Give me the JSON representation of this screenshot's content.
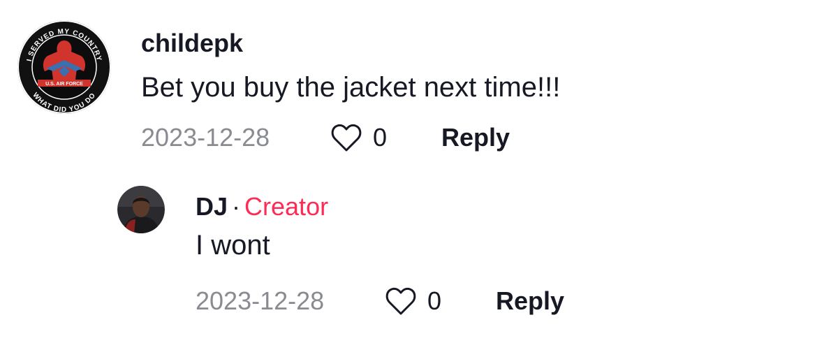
{
  "comments": [
    {
      "username": "childepk",
      "text": "Bet you buy the jacket next time!!!",
      "date": "2023-12-28",
      "likes": "0",
      "reply_label": "Reply",
      "avatar": {
        "type": "badge",
        "top_text": "I SERVED MY COUNTRY",
        "bottom_text": "WHAT DID YOU DO",
        "band_text": "U.S. AIR FORCE",
        "colors": {
          "ring": "#111111",
          "text": "#ffffff",
          "accent": "#d0342c",
          "blue": "#3a6fb0"
        }
      }
    },
    {
      "username": "DJ",
      "separator": "·",
      "badge": "Creator",
      "text": "I wont",
      "date": "2023-12-28",
      "likes": "0",
      "reply_label": "Reply",
      "avatar": {
        "type": "photo"
      }
    }
  ],
  "colors": {
    "creator": "#fe2c55",
    "meta_gray": "#8a8b91",
    "text": "#161823"
  },
  "icons": [
    "heart-outline-icon"
  ]
}
